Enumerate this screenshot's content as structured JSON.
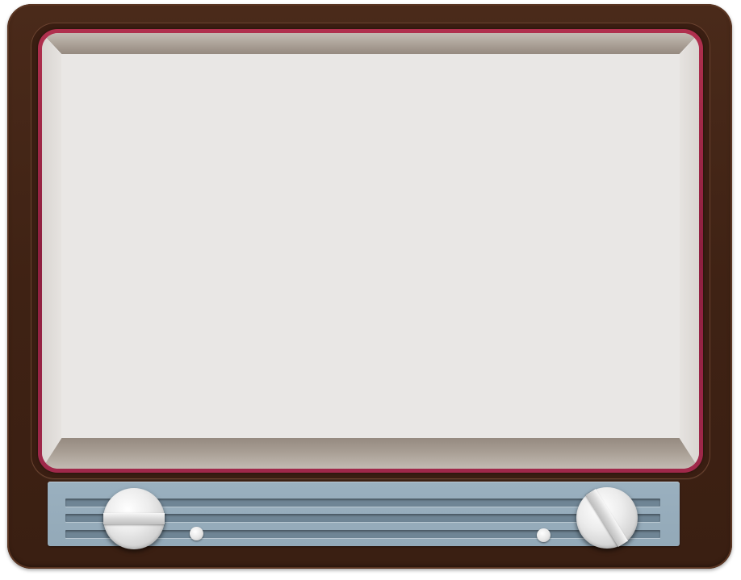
{
  "tv": {
    "cabinet_color": "#3f2214",
    "trim_color": "#a0284a",
    "screen_color": "#e9e7e5",
    "panel_color": "#98aebd",
    "knob_color": "#e6e6e6"
  },
  "controls": {
    "knobs": [
      {
        "icon": "control-knob-icon",
        "orientation": "horizontal"
      },
      {
        "icon": "control-knob-icon",
        "orientation": "diagonal"
      }
    ],
    "indicators": [
      {
        "icon": "indicator-dot-icon"
      },
      {
        "icon": "indicator-dot-icon"
      }
    ],
    "grille_slots": 3
  }
}
